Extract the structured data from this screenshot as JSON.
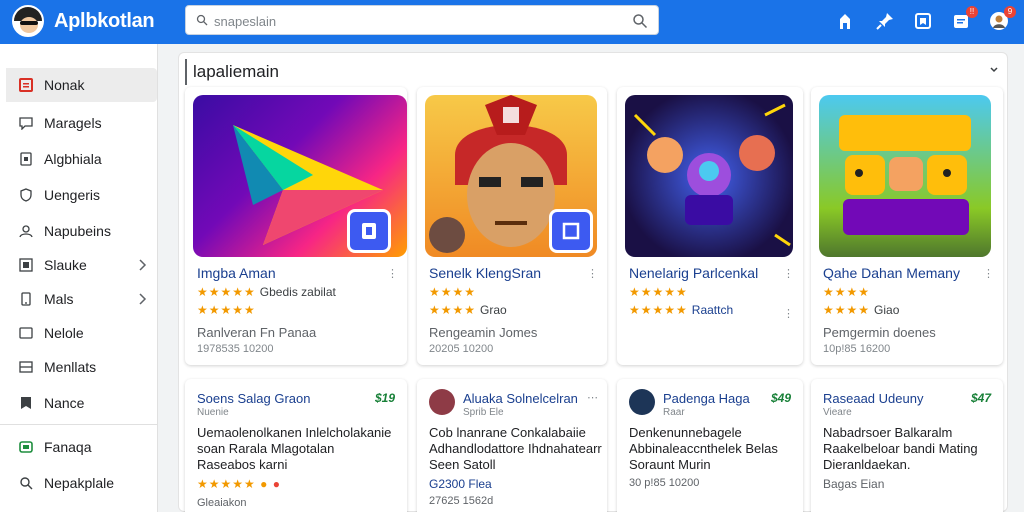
{
  "header": {
    "app_name": "Aplbkotlan",
    "search_placeholder": "snapeslain",
    "icons": [
      "home-icon",
      "pin-icon",
      "bookmark-icon",
      "notification-icon",
      "account-icon"
    ],
    "badges": {
      "notifications": "!!",
      "account": "9"
    },
    "brand_color": "#1a73e8"
  },
  "sidebar": {
    "items": [
      {
        "label": "Nonak",
        "icon": "square-icon",
        "active": true
      },
      {
        "label": "Maragels",
        "icon": "chat-icon"
      },
      {
        "label": "Algbhiala",
        "icon": "tablet-icon"
      },
      {
        "label": "Uengeris",
        "icon": "shield-icon"
      },
      {
        "label": "Napubeins",
        "icon": "user-icon"
      },
      {
        "label": "Slauke",
        "icon": "grid-icon",
        "chevron": true
      },
      {
        "label": "Mals",
        "icon": "phone-icon",
        "chevron": true
      },
      {
        "label": "Nelole",
        "icon": "box-icon"
      },
      {
        "label": "Menllats",
        "icon": "rows-icon"
      },
      {
        "label": "Nance",
        "icon": "bookmark-icon"
      },
      {
        "label": "Fanaqa",
        "icon": "game-icon"
      },
      {
        "label": "Nepakplale",
        "icon": "search-icon"
      }
    ]
  },
  "section": {
    "title": "lapaliemain"
  },
  "top_cards": [
    {
      "title": "Imgba Aman",
      "rating_text": "Gbedis zabilat",
      "sub": "Ranlveran Fn Panaa",
      "meta": "1978535 10200"
    },
    {
      "title": "Senelk KlengSran",
      "rating_text": "Grao",
      "sub": "Rengeamin Jomes",
      "meta": "20205 10200"
    },
    {
      "title": "Nenelarig Parlcenkal",
      "rating_text": "Raattch",
      "sub": "",
      "meta": ""
    },
    {
      "title": "Qahe Dahan Memany",
      "rating_text": "Giao",
      "sub": "Pemgermin doenes",
      "meta": "10p!85 16200"
    }
  ],
  "bottom_cards": [
    {
      "title": "Soens Salag Graon",
      "sub": "Nuenie",
      "price": "$19",
      "lines": [
        "Uemaolenolkanen Inlelcholakanie",
        "soan Rarala Mlagotalan",
        "Raseabos karni"
      ],
      "foot": "",
      "foot_small": "Gleaiakon"
    },
    {
      "title": "Aluaka Solnelcelran",
      "sub": "Sprib Ele",
      "price": "",
      "lines": [
        "Cob lnanrane Conkalabaiie",
        "Adhandlodattore Ihdnahatearr",
        "Seen Satoll"
      ],
      "foot": "G2300 Flea",
      "foot_small": "27625 1562d"
    },
    {
      "title": "Padenga Haga",
      "sub": "Raar",
      "price": "$49",
      "lines": [
        "Denkenunnebagele",
        "Abbinaleaccnthelek Belas",
        "Soraunt Murin"
      ],
      "foot": "",
      "foot_small": "30 p!85 10200"
    },
    {
      "title": "Raseaad Udeuny",
      "sub": "Vieare",
      "price": "$47",
      "lines": [
        "Nabadrsoer Balkaralm",
        "Raakelbeloar bandi Mating",
        "Dieranldaekan."
      ],
      "foot": "Bagas Eian",
      "foot_small": ""
    }
  ]
}
